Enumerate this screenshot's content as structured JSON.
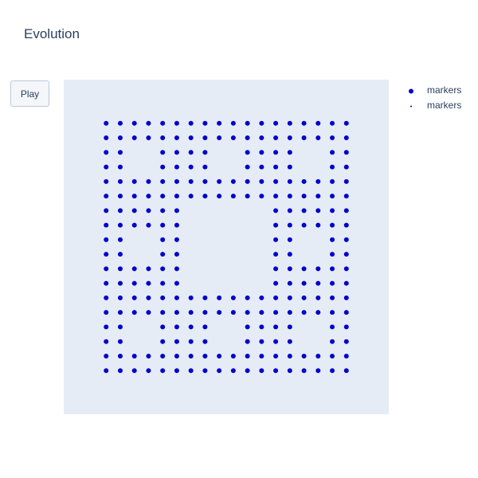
{
  "title": "Evolution",
  "controls": {
    "play_label": "Play"
  },
  "legend": [
    {
      "label": "markers",
      "marker": "large-dot"
    },
    {
      "label": "markers",
      "marker": "small-dot"
    }
  ],
  "colors": {
    "plot_bg": "#e5ecf6",
    "marker": "#0000cc",
    "text": "#2a3f5f"
  },
  "chart_data": {
    "type": "scatter",
    "title": "Evolution",
    "xlabel": "",
    "ylabel": "",
    "grid": false,
    "legend_position": "top-right",
    "xlim": [
      -3,
      20
    ],
    "ylim": [
      -3,
      20
    ],
    "series": [
      {
        "name": "markers",
        "marker_size": "large",
        "points": [
          [
            0,
            17
          ],
          [
            1,
            17
          ],
          [
            2,
            17
          ],
          [
            3,
            17
          ],
          [
            4,
            17
          ],
          [
            5,
            17
          ],
          [
            6,
            17
          ],
          [
            7,
            17
          ],
          [
            8,
            17
          ],
          [
            9,
            17
          ],
          [
            10,
            17
          ],
          [
            11,
            17
          ],
          [
            12,
            17
          ],
          [
            13,
            17
          ],
          [
            14,
            17
          ],
          [
            15,
            17
          ],
          [
            16,
            17
          ],
          [
            17,
            17
          ],
          [
            0,
            16
          ],
          [
            1,
            16
          ],
          [
            2,
            16
          ],
          [
            3,
            16
          ],
          [
            4,
            16
          ],
          [
            5,
            16
          ],
          [
            6,
            16
          ],
          [
            7,
            16
          ],
          [
            8,
            16
          ],
          [
            9,
            16
          ],
          [
            10,
            16
          ],
          [
            11,
            16
          ],
          [
            12,
            16
          ],
          [
            13,
            16
          ],
          [
            14,
            16
          ],
          [
            15,
            16
          ],
          [
            16,
            16
          ],
          [
            17,
            16
          ],
          [
            0,
            15
          ],
          [
            1,
            15
          ],
          [
            4,
            15
          ],
          [
            5,
            15
          ],
          [
            6,
            15
          ],
          [
            7,
            15
          ],
          [
            10,
            15
          ],
          [
            11,
            15
          ],
          [
            12,
            15
          ],
          [
            13,
            15
          ],
          [
            16,
            15
          ],
          [
            17,
            15
          ],
          [
            0,
            14
          ],
          [
            1,
            14
          ],
          [
            4,
            14
          ],
          [
            5,
            14
          ],
          [
            6,
            14
          ],
          [
            7,
            14
          ],
          [
            10,
            14
          ],
          [
            11,
            14
          ],
          [
            12,
            14
          ],
          [
            13,
            14
          ],
          [
            16,
            14
          ],
          [
            17,
            14
          ],
          [
            0,
            13
          ],
          [
            1,
            13
          ],
          [
            2,
            13
          ],
          [
            3,
            13
          ],
          [
            4,
            13
          ],
          [
            5,
            13
          ],
          [
            6,
            13
          ],
          [
            7,
            13
          ],
          [
            8,
            13
          ],
          [
            9,
            13
          ],
          [
            10,
            13
          ],
          [
            11,
            13
          ],
          [
            12,
            13
          ],
          [
            13,
            13
          ],
          [
            14,
            13
          ],
          [
            15,
            13
          ],
          [
            16,
            13
          ],
          [
            17,
            13
          ],
          [
            0,
            12
          ],
          [
            1,
            12
          ],
          [
            2,
            12
          ],
          [
            3,
            12
          ],
          [
            4,
            12
          ],
          [
            5,
            12
          ],
          [
            6,
            12
          ],
          [
            7,
            12
          ],
          [
            8,
            12
          ],
          [
            9,
            12
          ],
          [
            10,
            12
          ],
          [
            11,
            12
          ],
          [
            12,
            12
          ],
          [
            13,
            12
          ],
          [
            14,
            12
          ],
          [
            15,
            12
          ],
          [
            16,
            12
          ],
          [
            17,
            12
          ],
          [
            0,
            11
          ],
          [
            1,
            11
          ],
          [
            2,
            11
          ],
          [
            3,
            11
          ],
          [
            4,
            11
          ],
          [
            5,
            11
          ],
          [
            12,
            11
          ],
          [
            13,
            11
          ],
          [
            14,
            11
          ],
          [
            15,
            11
          ],
          [
            16,
            11
          ],
          [
            17,
            11
          ],
          [
            0,
            10
          ],
          [
            1,
            10
          ],
          [
            2,
            10
          ],
          [
            3,
            10
          ],
          [
            4,
            10
          ],
          [
            5,
            10
          ],
          [
            12,
            10
          ],
          [
            13,
            10
          ],
          [
            14,
            10
          ],
          [
            15,
            10
          ],
          [
            16,
            10
          ],
          [
            17,
            10
          ],
          [
            0,
            9
          ],
          [
            1,
            9
          ],
          [
            4,
            9
          ],
          [
            5,
            9
          ],
          [
            12,
            9
          ],
          [
            13,
            9
          ],
          [
            16,
            9
          ],
          [
            17,
            9
          ],
          [
            0,
            8
          ],
          [
            1,
            8
          ],
          [
            4,
            8
          ],
          [
            5,
            8
          ],
          [
            12,
            8
          ],
          [
            13,
            8
          ],
          [
            16,
            8
          ],
          [
            17,
            8
          ],
          [
            0,
            7
          ],
          [
            1,
            7
          ],
          [
            2,
            7
          ],
          [
            3,
            7
          ],
          [
            4,
            7
          ],
          [
            5,
            7
          ],
          [
            12,
            7
          ],
          [
            13,
            7
          ],
          [
            14,
            7
          ],
          [
            15,
            7
          ],
          [
            16,
            7
          ],
          [
            17,
            7
          ],
          [
            0,
            6
          ],
          [
            1,
            6
          ],
          [
            2,
            6
          ],
          [
            3,
            6
          ],
          [
            4,
            6
          ],
          [
            5,
            6
          ],
          [
            12,
            6
          ],
          [
            13,
            6
          ],
          [
            14,
            6
          ],
          [
            15,
            6
          ],
          [
            16,
            6
          ],
          [
            17,
            6
          ],
          [
            0,
            5
          ],
          [
            1,
            5
          ],
          [
            2,
            5
          ],
          [
            3,
            5
          ],
          [
            4,
            5
          ],
          [
            5,
            5
          ],
          [
            6,
            5
          ],
          [
            7,
            5
          ],
          [
            8,
            5
          ],
          [
            9,
            5
          ],
          [
            10,
            5
          ],
          [
            11,
            5
          ],
          [
            12,
            5
          ],
          [
            13,
            5
          ],
          [
            14,
            5
          ],
          [
            15,
            5
          ],
          [
            16,
            5
          ],
          [
            17,
            5
          ],
          [
            0,
            4
          ],
          [
            1,
            4
          ],
          [
            2,
            4
          ],
          [
            3,
            4
          ],
          [
            4,
            4
          ],
          [
            5,
            4
          ],
          [
            6,
            4
          ],
          [
            7,
            4
          ],
          [
            8,
            4
          ],
          [
            9,
            4
          ],
          [
            10,
            4
          ],
          [
            11,
            4
          ],
          [
            12,
            4
          ],
          [
            13,
            4
          ],
          [
            14,
            4
          ],
          [
            15,
            4
          ],
          [
            16,
            4
          ],
          [
            17,
            4
          ],
          [
            0,
            3
          ],
          [
            1,
            3
          ],
          [
            4,
            3
          ],
          [
            5,
            3
          ],
          [
            6,
            3
          ],
          [
            7,
            3
          ],
          [
            10,
            3
          ],
          [
            11,
            3
          ],
          [
            12,
            3
          ],
          [
            13,
            3
          ],
          [
            16,
            3
          ],
          [
            17,
            3
          ],
          [
            0,
            2
          ],
          [
            1,
            2
          ],
          [
            4,
            2
          ],
          [
            5,
            2
          ],
          [
            6,
            2
          ],
          [
            7,
            2
          ],
          [
            10,
            2
          ],
          [
            11,
            2
          ],
          [
            12,
            2
          ],
          [
            13,
            2
          ],
          [
            16,
            2
          ],
          [
            17,
            2
          ],
          [
            0,
            1
          ],
          [
            1,
            1
          ],
          [
            2,
            1
          ],
          [
            3,
            1
          ],
          [
            4,
            1
          ],
          [
            5,
            1
          ],
          [
            6,
            1
          ],
          [
            7,
            1
          ],
          [
            8,
            1
          ],
          [
            9,
            1
          ],
          [
            10,
            1
          ],
          [
            11,
            1
          ],
          [
            12,
            1
          ],
          [
            13,
            1
          ],
          [
            14,
            1
          ],
          [
            15,
            1
          ],
          [
            16,
            1
          ],
          [
            17,
            1
          ],
          [
            0,
            0
          ],
          [
            1,
            0
          ],
          [
            2,
            0
          ],
          [
            3,
            0
          ],
          [
            4,
            0
          ],
          [
            5,
            0
          ],
          [
            6,
            0
          ],
          [
            7,
            0
          ],
          [
            8,
            0
          ],
          [
            9,
            0
          ],
          [
            10,
            0
          ],
          [
            11,
            0
          ],
          [
            12,
            0
          ],
          [
            13,
            0
          ],
          [
            14,
            0
          ],
          [
            15,
            0
          ],
          [
            16,
            0
          ],
          [
            17,
            0
          ]
        ]
      },
      {
        "name": "markers",
        "marker_size": "small",
        "points": []
      }
    ]
  }
}
